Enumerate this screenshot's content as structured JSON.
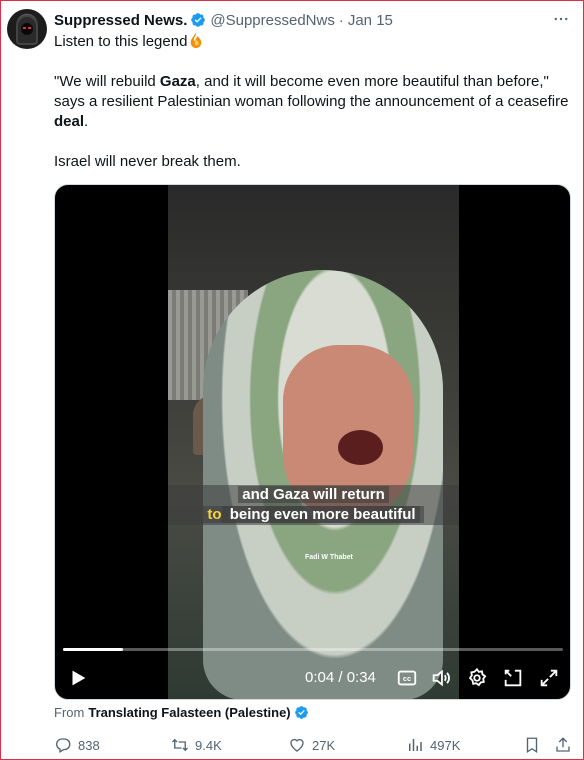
{
  "author": {
    "name": "Suppressed News.",
    "handle": "@SuppressedNws",
    "separator": "·",
    "date": "Jan 15"
  },
  "tweet": {
    "line1": "Listen to this legend",
    "quote_part1": "\"We will rebuild ",
    "quote_bold1": "Gaza",
    "quote_part2": ", and it will become even more beautiful than before,\" says a resilient Palestinian woman following the announcement of a ceasefire ",
    "quote_bold2": "deal",
    "quote_part3": ".",
    "closing": "Israel will never break them."
  },
  "video": {
    "subtitle_line1": "and Gaza will return",
    "subtitle_hl": "to",
    "subtitle_line2_rest": " being even more beautiful",
    "credit": "Fadi W Thabet",
    "time": "0:04 / 0:34",
    "progress": 0.12
  },
  "source": {
    "prefix": "From",
    "name": "Translating Falasteen (Palestine)"
  },
  "actions": {
    "replies": "838",
    "reposts": "9.4K",
    "likes": "27K",
    "views": "497K"
  },
  "colors": {
    "verified": "#1d9bf0",
    "muted": "#536471",
    "text": "#0f1419"
  }
}
